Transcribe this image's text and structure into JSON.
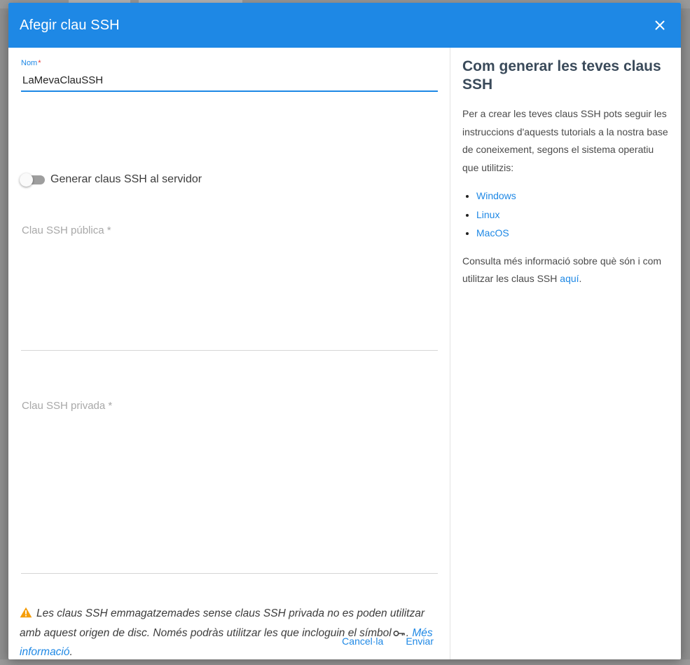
{
  "dialog": {
    "title": "Afegir clau SSH"
  },
  "form": {
    "name": {
      "label": "Nom",
      "required_mark": "*",
      "value": "LaMevaClauSSH"
    },
    "toggle": {
      "label": "Generar claus SSH al servidor",
      "checked": false
    },
    "public_key": {
      "label": "Clau SSH pública *",
      "value": ""
    },
    "private_key": {
      "label": "Clau SSH privada *",
      "value": ""
    },
    "warning": {
      "text_before": "Les claus SSH emmagatzemades sense claus SSH privada no es poden utilitzar amb aquest origen de disc. Només podràs utilitzar les que incloguin el símbol",
      "text_after": ".",
      "link": "Més informació",
      "end": "."
    },
    "buttons": {
      "cancel": "Cancel·la",
      "submit": "Enviar"
    }
  },
  "help": {
    "title": "Com generar les teves claus SSH",
    "intro": "Per a crear les teves claus SSH pots seguir les instruccions d'aquests tutorials a la nostra base de coneixement, segons el sistema operatiu que utilitzis:",
    "links": [
      "Windows",
      "Linux",
      "MacOS"
    ],
    "more_text": "Consulta més informació sobre què són i com utilitzar les claus SSH",
    "more_link": "aquí",
    "more_end": "."
  },
  "colors": {
    "primary": "#1e88e5",
    "warning": "#f59e0b",
    "required": "#e53935"
  },
  "icons": {
    "close": "close-icon",
    "warning": "warning-icon",
    "key": "key-icon"
  }
}
